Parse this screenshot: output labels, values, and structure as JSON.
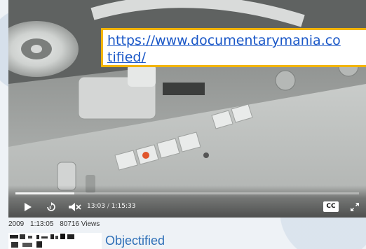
{
  "overlay": {
    "url_line1": "https://www.documentarymania.co",
    "url_line2": "tified/"
  },
  "player": {
    "current_time": "13:03",
    "separator": "/",
    "duration": "1:15:33",
    "progress": 0.172,
    "cc_label": "CC",
    "icons": [
      "play-icon",
      "skip-back-icon",
      "volume-muted-icon",
      "fullscreen-icon"
    ]
  },
  "meta": {
    "year": "2009",
    "length": "1:13:05",
    "views": "80716 Views"
  },
  "related": {
    "title": "Objectified"
  }
}
